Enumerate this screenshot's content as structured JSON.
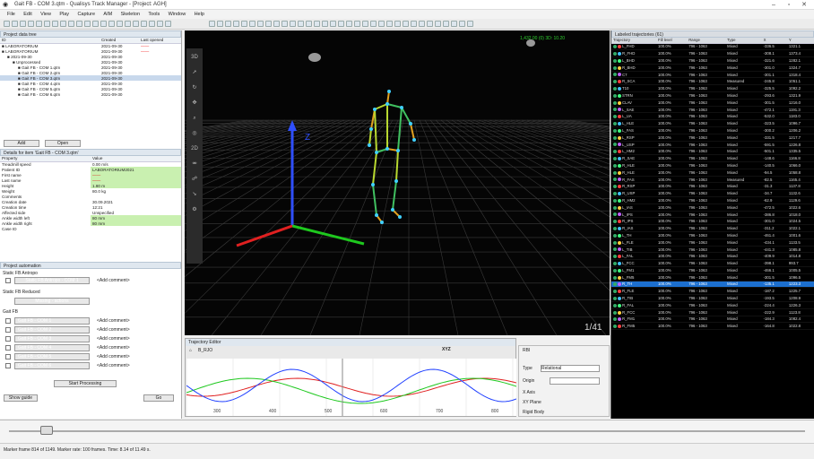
{
  "window": {
    "title": "Gait FB - COM 3.qtm - Qualisys Track Manager - [Project: AGH]"
  },
  "menu": [
    "File",
    "Edit",
    "View",
    "Play",
    "Capture",
    "AIM",
    "Skeleton",
    "Tools",
    "Window",
    "Help"
  ],
  "project_tree": {
    "header": "Project data tree",
    "col_id": "ID",
    "col_created": "Created",
    "col_last": "Last opened",
    "rows": [
      {
        "name": "LABORATORIUM",
        "created": "2021-09-30",
        "last": "——"
      },
      {
        "name": "LABORATORIUM",
        "created": "2021-09-30",
        "last": "——"
      },
      {
        "name": "2021-09-30",
        "created": "2021-09-30",
        "last": ""
      },
      {
        "name": "Unprocessed",
        "created": "2021-09-30",
        "last": ""
      },
      {
        "name": "Gait FB - COM 1.qtm",
        "created": "2021-09-30",
        "last": ""
      },
      {
        "name": "Gait FB - COM 2.qtm",
        "created": "2021-09-30",
        "last": ""
      },
      {
        "name": "Gait FB - COM 3.qtm",
        "created": "2021-09-30",
        "last": ""
      },
      {
        "name": "Gait FB - COM 4.qtm",
        "created": "2021-09-30",
        "last": ""
      },
      {
        "name": "Gait FB - COM 5.qtm",
        "created": "2021-09-30",
        "last": ""
      },
      {
        "name": "Gait FB - COM 6.qtm",
        "created": "2021-09-30",
        "last": ""
      }
    ],
    "add_label": "Add",
    "open_label": "Open"
  },
  "details": {
    "header": "Details for item 'Gait FB - COM 3.qtm'",
    "col_prop": "Property",
    "col_val": "Value",
    "rows": [
      {
        "p": "Treadmill speed",
        "v": "0.00 m/s"
      },
      {
        "p": "Patient ID",
        "v": "LABORATORIUM2021"
      },
      {
        "p": "First name",
        "v": "——"
      },
      {
        "p": "Last name",
        "v": "——"
      },
      {
        "p": "Height",
        "v": "1.80 m"
      },
      {
        "p": "Weight",
        "v": "80.0 kg"
      },
      {
        "p": "Comments",
        "v": ""
      },
      {
        "p": "Creation date",
        "v": "30.09.2021"
      },
      {
        "p": "Creation time",
        "v": "12:21"
      },
      {
        "p": "Affected side",
        "v": "Unspecified"
      },
      {
        "p": "Ankle width left",
        "v": "80 mm"
      },
      {
        "p": "Ankle width right",
        "v": "80 mm"
      },
      {
        "p": "Case ID",
        "v": ""
      }
    ]
  },
  "automation": {
    "header": "Project automation",
    "static_header": "Static FB Antropo",
    "static_btn": "Static FB Antropo - COM 1",
    "static_comment": "<Add comment>",
    "reduce_header": "Static FB Reduced",
    "missing_btn": "Missing - actions",
    "gait_header": "Gait FB",
    "gait_items": [
      "Gait FB - COM 1",
      "Gait FB - COM 2",
      "Gait FB - COM 3",
      "Gait FB - COM 4",
      "Gait FB - COM 5",
      "Gait FB - COM 6"
    ],
    "gait_comment": "<Add comment>",
    "start_btn": "Start Processing",
    "guide_btn": "Show guide",
    "go_btn": "Go"
  },
  "viewport": {
    "frame_counter": "1/41",
    "axis_z": "Z",
    "top_info": "1,432.00 (0) 3D: 10.20"
  },
  "traj_editor": {
    "header": "Trajectory Editor",
    "marker": "B_RJO",
    "axis_select": "XYZ",
    "ticks": [
      "300",
      "400",
      "500",
      "600",
      "700",
      "800"
    ]
  },
  "properties": {
    "header": "RBI",
    "type_label": "Type",
    "type_value": "Relational",
    "origin_label": "Origin",
    "xaxis_label": "X Axis",
    "xyplane_label": "XY Plane",
    "rigid_label": "Rigid Body"
  },
  "labeled": {
    "header": "Labeled trajectories (61)",
    "cols": [
      "Trajectory",
      "Fill level",
      "Range",
      "Type",
      "X",
      "Y"
    ],
    "rows": [
      {
        "n": "L_FHD",
        "f": "100.0%",
        "r": "796 - 1063",
        "t": "Mixed",
        "x": "-336.5",
        "y": "1321.1"
      },
      {
        "n": "R_FHD",
        "f": "100.0%",
        "r": "796 - 1063",
        "t": "Mixed",
        "x": "-308.1",
        "y": "1373.4"
      },
      {
        "n": "L_BHD",
        "f": "100.0%",
        "r": "796 - 1063",
        "t": "Mixed",
        "x": "-321.6",
        "y": "1282.1"
      },
      {
        "n": "R_BHD",
        "f": "100.0%",
        "r": "796 - 1063",
        "t": "Mixed",
        "x": "-301.0",
        "y": "1324.7"
      },
      {
        "n": "C7",
        "f": "100.0%",
        "r": "796 - 1063",
        "t": "Mixed",
        "x": "-301.1",
        "y": "1318.4"
      },
      {
        "n": "R_SCA",
        "f": "100.0%",
        "r": "796 - 1063",
        "t": "Measured",
        "x": "-245.8",
        "y": "1051.1"
      },
      {
        "n": "T10",
        "f": "100.0%",
        "r": "796 - 1063",
        "t": "Mixed",
        "x": "-325.5",
        "y": "1092.2"
      },
      {
        "n": "STRN",
        "f": "100.0%",
        "r": "796 - 1063",
        "t": "Mixed",
        "x": "-293.6",
        "y": "1321.9"
      },
      {
        "n": "CLAV",
        "f": "100.0%",
        "r": "796 - 1063",
        "t": "Mixed",
        "x": "-301.5",
        "y": "1216.0"
      },
      {
        "n": "L_SAE",
        "f": "100.0%",
        "r": "796 - 1063",
        "t": "Mixed",
        "x": "-472.1",
        "y": "1191.3"
      },
      {
        "n": "L_UA",
        "f": "100.0%",
        "r": "796 - 1063",
        "t": "Mixed",
        "x": "-532.0",
        "y": "1183.0"
      },
      {
        "n": "L_HLE",
        "f": "100.0%",
        "r": "796 - 1063",
        "t": "Mixed",
        "x": "-323.5",
        "y": "1096.7"
      },
      {
        "n": "L_FAS",
        "f": "100.0%",
        "r": "796 - 1063",
        "t": "Mixed",
        "x": "-300.2",
        "y": "1206.2"
      },
      {
        "n": "L_RSP",
        "f": "100.0%",
        "r": "796 - 1063",
        "t": "Mixed",
        "x": "-331.5",
        "y": "1217.7"
      },
      {
        "n": "L_USP",
        "f": "100.0%",
        "r": "796 - 1063",
        "t": "Mixed",
        "x": "-591.5",
        "y": "1226.8"
      },
      {
        "n": "L_HM2",
        "f": "100.0%",
        "r": "796 - 1063",
        "t": "Mixed",
        "x": "-501.1",
        "y": "1335.5"
      },
      {
        "n": "R_SAE",
        "f": "100.0%",
        "r": "796 - 1063",
        "t": "Mixed",
        "x": "-148.6",
        "y": "1166.8"
      },
      {
        "n": "R_HLE",
        "f": "100.0%",
        "r": "796 - 1063",
        "t": "Mixed",
        "x": "-140.5",
        "y": "1066.0"
      },
      {
        "n": "R_HLE",
        "f": "100.0%",
        "r": "796 - 1063",
        "t": "Mixed",
        "x": "-94.5",
        "y": "1058.8"
      },
      {
        "n": "R_FAS",
        "f": "100.0%",
        "r": "796 - 1063",
        "t": "Measured",
        "x": "-82.5",
        "y": "1165.4"
      },
      {
        "n": "R_RSP",
        "f": "100.0%",
        "r": "796 - 1063",
        "t": "Mixed",
        "x": "-31.3",
        "y": "1137.8"
      },
      {
        "n": "R_USP",
        "f": "100.0%",
        "r": "796 - 1063",
        "t": "Mixed",
        "x": "-34.7",
        "y": "1132.6"
      },
      {
        "n": "R_HM2",
        "f": "100.0%",
        "r": "796 - 1063",
        "t": "Mixed",
        "x": "-62.9",
        "y": "1129.6"
      },
      {
        "n": "L_IAS",
        "f": "100.0%",
        "r": "796 - 1063",
        "t": "Mixed",
        "x": "-472.5",
        "y": "1022.6"
      },
      {
        "n": "L_IPS",
        "f": "100.0%",
        "r": "796 - 1063",
        "t": "Mixed",
        "x": "-386.8",
        "y": "1018.0"
      },
      {
        "n": "R_IPS",
        "f": "100.0%",
        "r": "796 - 1063",
        "t": "Mixed",
        "x": "-301.0",
        "y": "1024.5"
      },
      {
        "n": "R_IAS",
        "f": "100.0%",
        "r": "796 - 1063",
        "t": "Mixed",
        "x": "-311.2",
        "y": "1022.1"
      },
      {
        "n": "L_TH",
        "f": "100.0%",
        "r": "796 - 1063",
        "t": "Mixed",
        "x": "-461.4",
        "y": "1001.6"
      },
      {
        "n": "L_FLE",
        "f": "100.0%",
        "r": "796 - 1063",
        "t": "Mixed",
        "x": "-434.1",
        "y": "1133.5"
      },
      {
        "n": "L_TIB",
        "f": "100.0%",
        "r": "796 - 1063",
        "t": "Mixed",
        "x": "-441.3",
        "y": "1085.8"
      },
      {
        "n": "L_FAL",
        "f": "100.0%",
        "r": "796 - 1063",
        "t": "Mixed",
        "x": "-409.9",
        "y": "1014.8"
      },
      {
        "n": "L_FCC",
        "f": "100.0%",
        "r": "796 - 1063",
        "t": "Mixed",
        "x": "-398.1",
        "y": "993.7"
      },
      {
        "n": "L_FM1",
        "f": "100.0%",
        "r": "796 - 1063",
        "t": "Mixed",
        "x": "-466.1",
        "y": "1005.5"
      },
      {
        "n": "L_FM5",
        "f": "100.0%",
        "r": "796 - 1063",
        "t": "Mixed",
        "x": "-301.5",
        "y": "1096.5"
      },
      {
        "n": "R_TH",
        "f": "100.0%",
        "r": "796 - 1063",
        "t": "Mixed",
        "x": "-135.1",
        "y": "1223.3"
      },
      {
        "n": "R_FLE",
        "f": "100.0%",
        "r": "796 - 1063",
        "t": "Mixed",
        "x": "-187.2",
        "y": "1225.7"
      },
      {
        "n": "R_TIB",
        "f": "100.0%",
        "r": "796 - 1063",
        "t": "Mixed",
        "x": "-193.5",
        "y": "1208.9"
      },
      {
        "n": "R_FAL",
        "f": "100.0%",
        "r": "796 - 1063",
        "t": "Mixed",
        "x": "-224.4",
        "y": "1226.3"
      },
      {
        "n": "R_FCC",
        "f": "100.0%",
        "r": "796 - 1063",
        "t": "Mixed",
        "x": "-222.9",
        "y": "1123.8"
      },
      {
        "n": "R_FM1",
        "f": "100.0%",
        "r": "796 - 1063",
        "t": "Mixed",
        "x": "-184.3",
        "y": "1082.4"
      },
      {
        "n": "R_FM5",
        "f": "100.0%",
        "r": "796 - 1063",
        "t": "Mixed",
        "x": "-164.8",
        "y": "1022.8"
      }
    ],
    "highlight_index": 34
  },
  "status": {
    "text": "Marker frame 814 of 1149. Marker rate: 100 frames. Time: 8.14 of 11.49 s."
  },
  "colors": {
    "bg3d": "#050505",
    "grid": "#3a3a3a",
    "accent": "#1c6fcf",
    "green": "#3fc03f",
    "red": "#ee3333"
  }
}
